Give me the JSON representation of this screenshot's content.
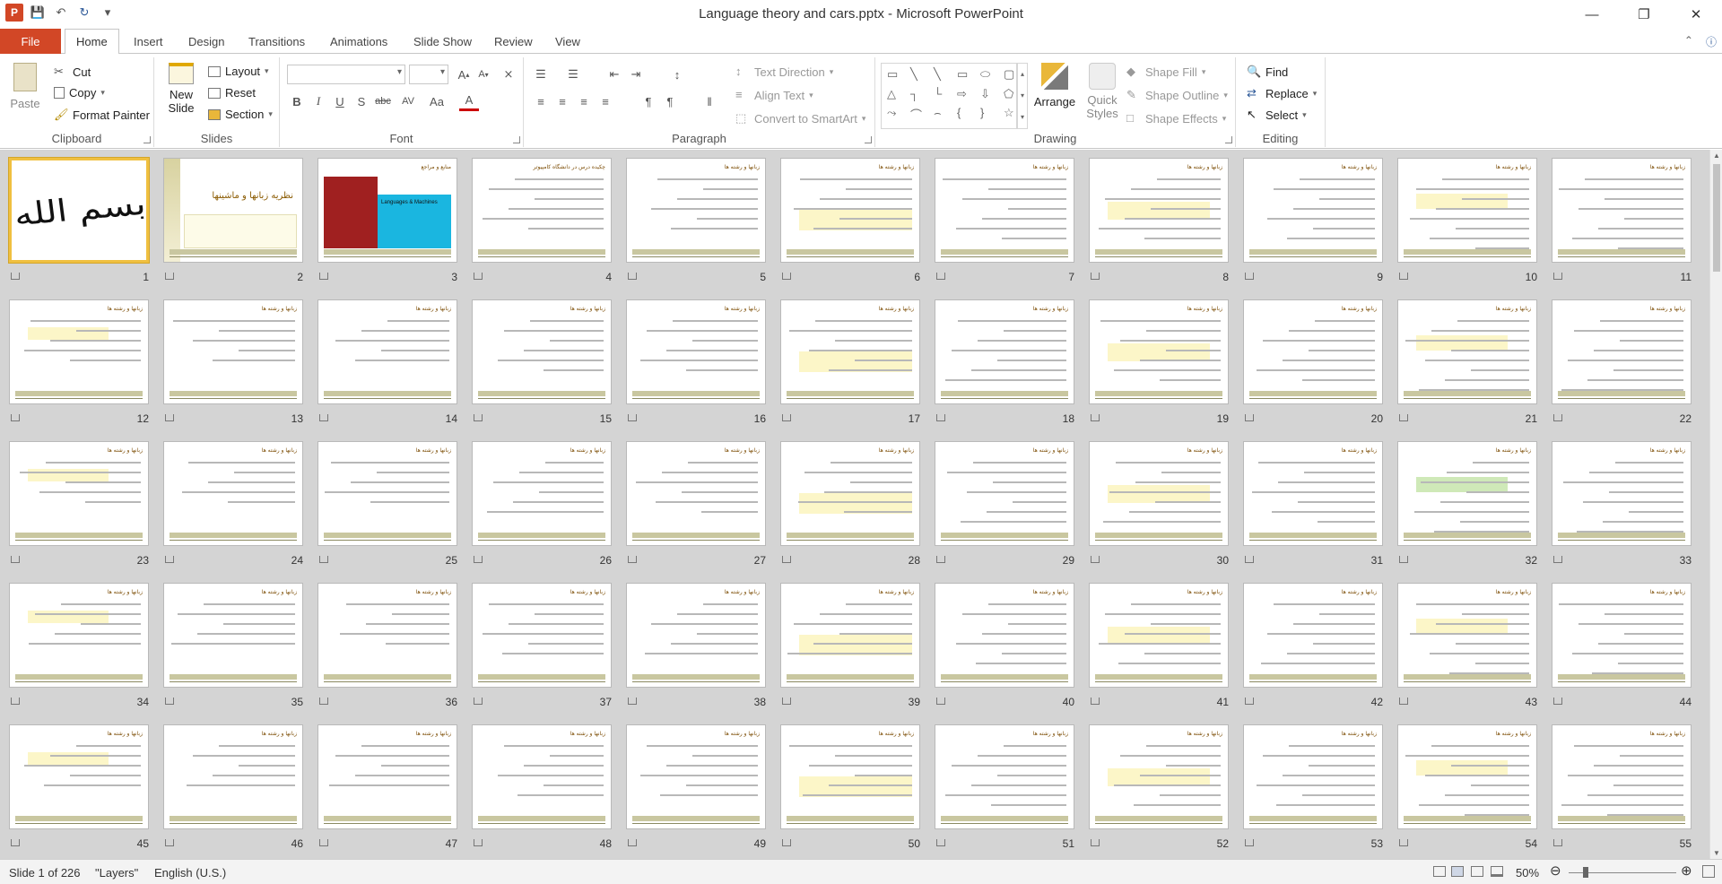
{
  "window": {
    "title": "Language theory and cars.pptx - Microsoft PowerPoint"
  },
  "qat": {
    "icons": [
      "powerpoint-logo-icon",
      "save-icon",
      "undo-icon",
      "redo-icon",
      "customize-qat-icon"
    ]
  },
  "tabs": {
    "file": "File",
    "items": [
      "Home",
      "Insert",
      "Design",
      "Transitions",
      "Animations",
      "Slide Show",
      "Review",
      "View"
    ],
    "active": "Home"
  },
  "ribbon": {
    "clipboard": {
      "label": "Clipboard",
      "paste": "Paste",
      "cut": "Cut",
      "copy": "Copy",
      "format_painter": "Format Painter"
    },
    "slides": {
      "label": "Slides",
      "new_slide": "New\nSlide",
      "new_slide_1": "New",
      "new_slide_2": "Slide",
      "layout": "Layout",
      "reset": "Reset",
      "section": "Section"
    },
    "font": {
      "label": "Font",
      "font_name": "",
      "font_size": ""
    },
    "paragraph": {
      "label": "Paragraph",
      "text_direction": "Text Direction",
      "align_text": "Align Text",
      "convert_smartart": "Convert to SmartArt"
    },
    "drawing": {
      "label": "Drawing",
      "arrange": "Arrange",
      "quick_styles_1": "Quick",
      "quick_styles_2": "Styles",
      "shape_fill": "Shape Fill",
      "shape_outline": "Shape Outline",
      "shape_effects": "Shape Effects"
    },
    "editing": {
      "label": "Editing",
      "find": "Find",
      "replace": "Replace",
      "select": "Select"
    }
  },
  "slides": {
    "total": 226,
    "selected": 1,
    "visible_numbers": [
      "1",
      "2",
      "3",
      "4",
      "5",
      "6",
      "7",
      "8",
      "9",
      "10",
      "11",
      "12",
      "13",
      "14",
      "15",
      "16",
      "17",
      "18",
      "19",
      "20",
      "21",
      "22",
      "23",
      "24",
      "25",
      "26",
      "27",
      "28",
      "29",
      "30",
      "31",
      "32",
      "33",
      "34",
      "35",
      "36",
      "37",
      "38",
      "39",
      "40",
      "41",
      "42",
      "43",
      "44",
      "45",
      "46",
      "47",
      "48",
      "49",
      "50",
      "51",
      "52",
      "53",
      "54",
      "55"
    ],
    "slide2_title": "نظریه زبانها و ماشینها",
    "slide3_book": "Languages & Machines",
    "slide4_title": "چکیده درس در دانشگاه کامپیوتر"
  },
  "status": {
    "slide_info": "Slide 1 of 226",
    "theme": "\"Layers\"",
    "language": "English (U.S.)",
    "zoom": "50%"
  },
  "colors": {
    "file_tab": "#d24726",
    "selection": "#f0c040",
    "slide_bar": "#c9c7a0",
    "sorter_bg": "#d4d4d4"
  }
}
